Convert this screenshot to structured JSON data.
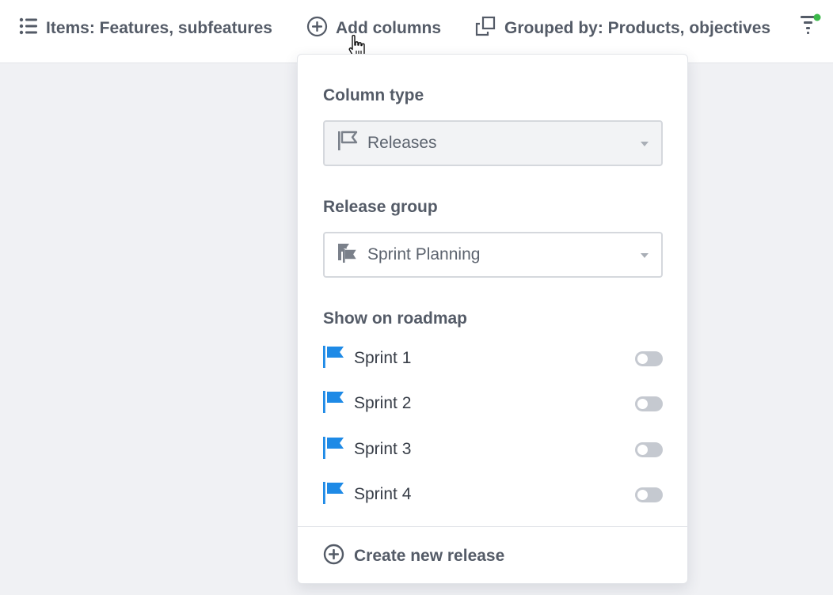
{
  "toolbar": {
    "items_label": "Items: Features, subfeatures",
    "add_columns_label": "Add columns",
    "grouped_label": "Grouped by: Products, objectives",
    "filter_active_color": "#3cb94a"
  },
  "dropdown": {
    "column_type_label": "Column type",
    "column_type_value": "Releases",
    "release_group_label": "Release group",
    "release_group_value": "Sprint Planning",
    "show_label": "Show on roadmap",
    "releases": [
      {
        "name": "Sprint 1",
        "enabled": false
      },
      {
        "name": "Sprint 2",
        "enabled": false
      },
      {
        "name": "Sprint 3",
        "enabled": false
      },
      {
        "name": "Sprint 4",
        "enabled": false
      }
    ],
    "create_label": "Create new release",
    "flag_color": "#1e8ae6"
  }
}
